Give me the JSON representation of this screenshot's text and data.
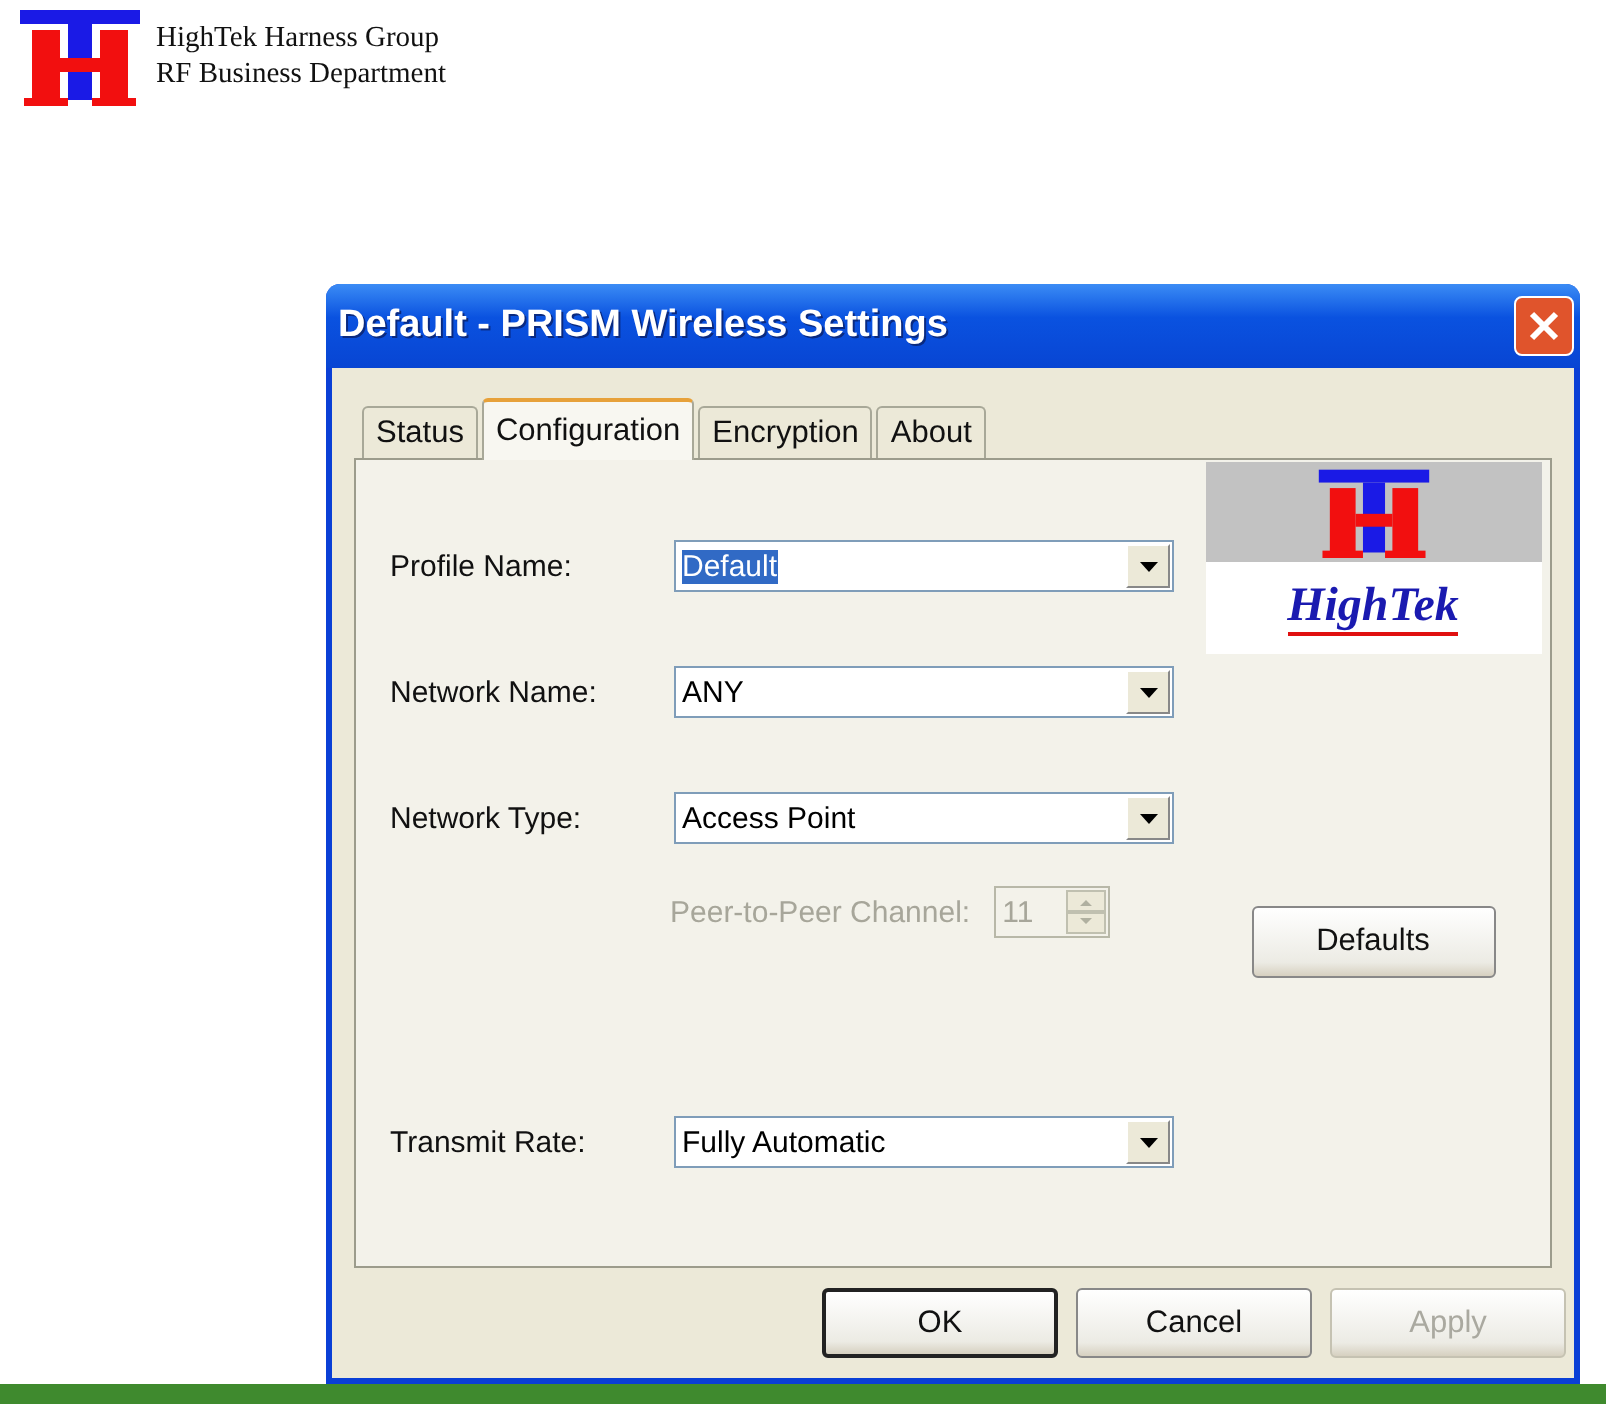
{
  "header": {
    "lines": [
      "HighTek Harness Group",
      "RF Business Department"
    ]
  },
  "window": {
    "title": "Default - PRISM Wireless Settings"
  },
  "tabs": [
    {
      "label": "Status",
      "selected": false
    },
    {
      "label": "Configuration",
      "selected": true
    },
    {
      "label": "Encryption",
      "selected": false
    },
    {
      "label": "About",
      "selected": false
    }
  ],
  "fields": [
    {
      "kind": "combo",
      "label": "Profile Name:",
      "value": "Default",
      "text_selected": true,
      "disabled": false
    },
    {
      "kind": "combo",
      "label": "Network Name:",
      "value": "ANY",
      "text_selected": false,
      "disabled": false
    },
    {
      "kind": "combo",
      "label": "Network Type:",
      "value": "Access Point",
      "text_selected": false,
      "disabled": false
    },
    {
      "kind": "spin",
      "label": "Peer-to-Peer Channel:",
      "value": "11",
      "text_selected": false,
      "disabled": true
    },
    {
      "kind": "combo",
      "label": "Transmit Rate:",
      "value": "Fully Automatic",
      "text_selected": false,
      "disabled": false
    }
  ],
  "brand": {
    "text": "HighTek"
  },
  "defaults_button": {
    "label": "Defaults"
  },
  "buttons": [
    {
      "label": "OK",
      "default": true,
      "disabled": false
    },
    {
      "label": "Cancel",
      "default": false,
      "disabled": false
    },
    {
      "label": "Apply",
      "default": false,
      "disabled": true
    }
  ]
}
